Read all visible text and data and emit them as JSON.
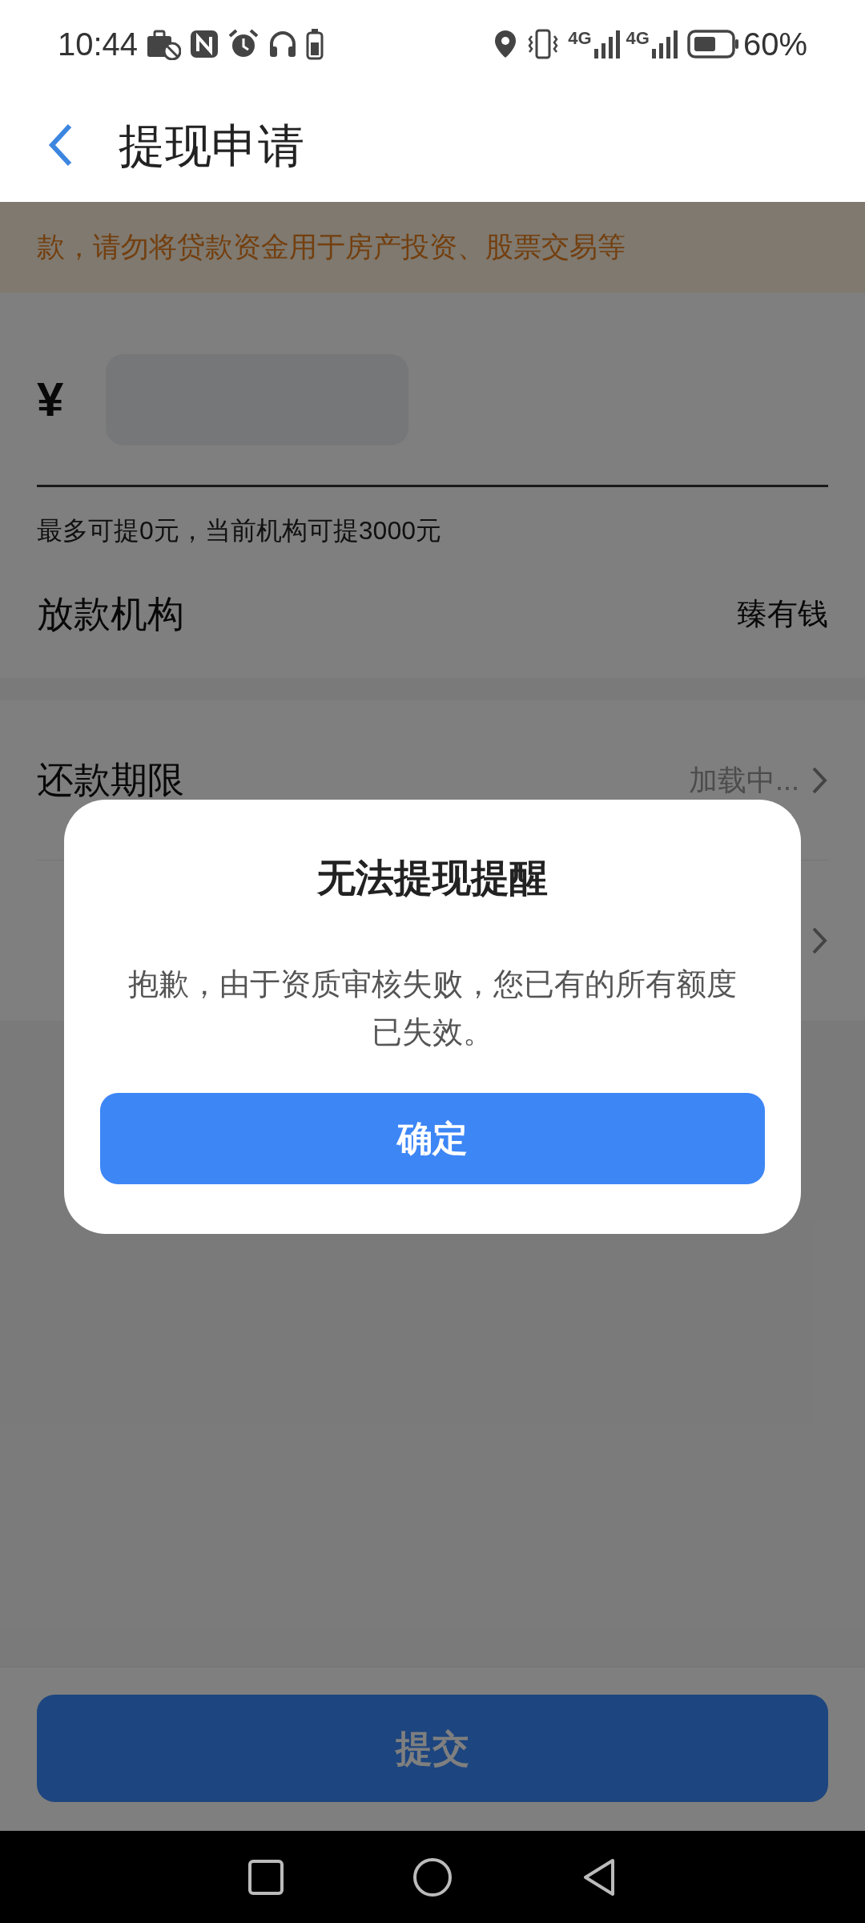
{
  "status_bar": {
    "time": "10:44",
    "network_labels": [
      "4G",
      "4G"
    ],
    "battery": "60%"
  },
  "header": {
    "title": "提现申请"
  },
  "notice": {
    "text": "款，请勿将贷款资金用于房产投资、股票交易等"
  },
  "amount": {
    "currency": "¥",
    "hint": "最多可提0元，当前机构可提3000元"
  },
  "lender": {
    "label": "放款机构",
    "value": "臻有钱"
  },
  "rows": [
    {
      "label": "还款期限",
      "value": "加载中...",
      "chevron": true
    },
    {
      "chevron": true
    }
  ],
  "submit_button": "提交",
  "dialog": {
    "title": "无法提现提醒",
    "message": "抱歉，由于资质审核失败，您已有的所有额度已失效。",
    "button": "确定"
  }
}
